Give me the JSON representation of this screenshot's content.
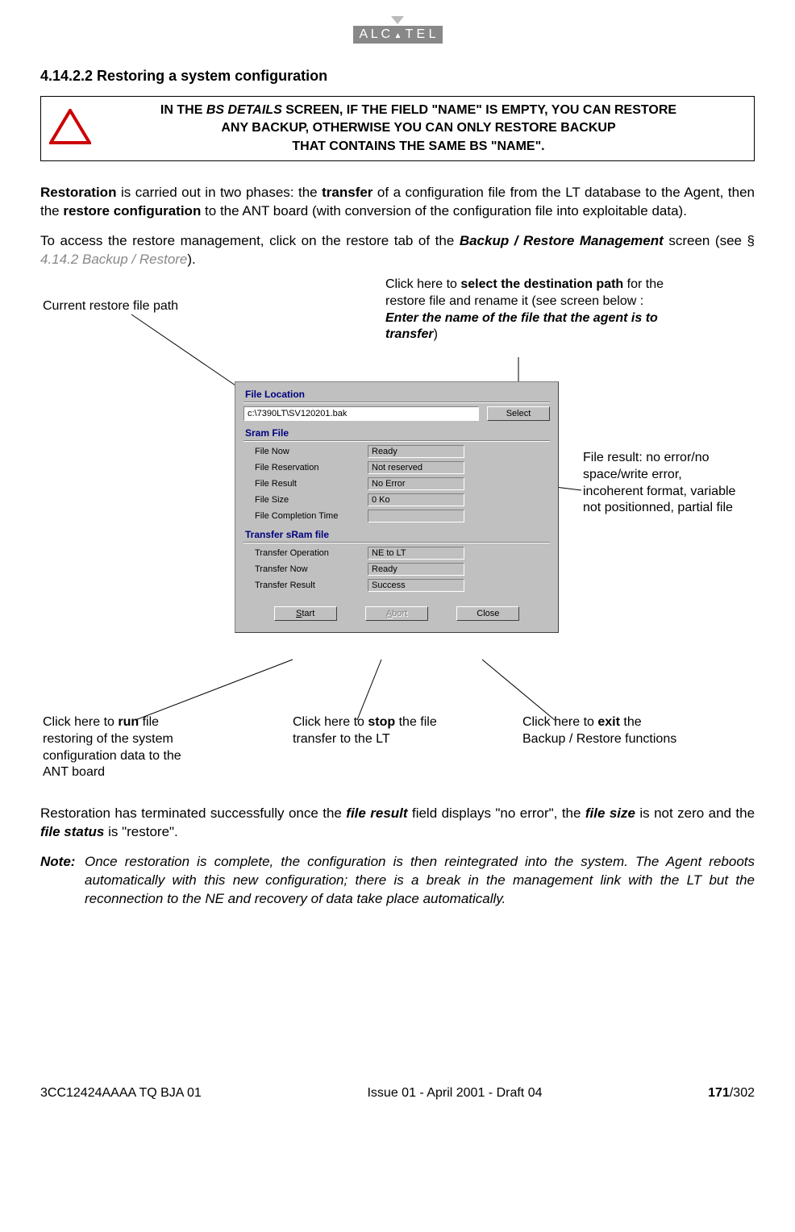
{
  "logo": "A L C A T E L",
  "heading": "4.14.2.2  Restoring a system configuration",
  "warning": {
    "l1a": "IN THE ",
    "l1b": "BS DETAILS",
    "l1c": " SCREEN, IF THE FIELD \"NAME\" IS EMPTY, YOU CAN RESTORE",
    "l2": "ANY BACKUP, OTHERWISE YOU CAN ONLY RESTORE BACKUP",
    "l3": "THAT CONTAINS THE SAME BS \"NAME\"."
  },
  "p1": {
    "a": "Restoration",
    "b": " is carried out in two phases: the ",
    "c": "transfer",
    "d": " of a configuration file from the LT database to the Agent, then the ",
    "e": "restore configuration",
    "f": " to the ANT board (with conversion of the configuration file into exploitable data)."
  },
  "p2": {
    "a": "To access the restore management, click on the restore tab of the ",
    "b": "Backup / Restore Management",
    "c": " screen (see § ",
    "d": "4.14.2 Backup / Restore",
    "e": ")."
  },
  "callouts": {
    "curpath": "Current restore file path",
    "dest_a": "Click here to ",
    "dest_b": "select the destination path",
    "dest_c": " for the restore file and rename it (see screen below : ",
    "dest_d": "Enter the name of the file that the agent is to transfer",
    "dest_e": ")",
    "fileres": "File result: no error/no space/write error, incoherent format, variable not positionned, partial file",
    "run_a": "Click here to ",
    "run_b": "run",
    "run_c": " file restoring of the system configuration data to the ANT board",
    "stop_a": "Click here to ",
    "stop_b": "stop",
    "stop_c": " the file transfer to the LT",
    "exit_a": "Click here to ",
    "exit_b": "exit",
    "exit_c": " the Backup / Restore functions"
  },
  "dialog": {
    "g1_title": "File Location",
    "path": "c:\\7390LT\\SV120201.bak",
    "select_btn": "Select",
    "g2_title": "Sram File",
    "rows2": {
      "r1l": "File Now",
      "r1v": "Ready",
      "r2l": "File Reservation",
      "r2v": "Not reserved",
      "r3l": "File Result",
      "r3v": "No Error",
      "r4l": "File Size",
      "r4v": "0 Ko",
      "r5l": "File Completion Time",
      "r5v": ""
    },
    "g3_title": "Transfer sRam file",
    "rows3": {
      "r1l": "Transfer Operation",
      "r1v": "NE to LT",
      "r2l": "Transfer Now",
      "r2v": "Ready",
      "r3l": "Transfer Result",
      "r3v": "Success"
    },
    "btn_start": "Start",
    "btn_abort": "Abort",
    "btn_close": "Close"
  },
  "p3": {
    "a": "Restoration has terminated successfully once the ",
    "b": "file result",
    "c": " field displays \"no error\", the ",
    "d": "file size",
    "e": " is not zero and the ",
    "f": "file status",
    "g": " is \"restore\"."
  },
  "note": {
    "label": "Note:",
    "body": "Once restoration is complete, the configuration is then reintegrated into the system. The Agent reboots automatically with this new configuration; there is a break in the management link with the LT but the reconnection to the NE and recovery of data take place automatically."
  },
  "footer": {
    "left": "3CC12424AAAA TQ BJA 01",
    "center": "Issue 01 - April 2001 - Draft 04",
    "right_a": "171",
    "right_b": "/302"
  }
}
